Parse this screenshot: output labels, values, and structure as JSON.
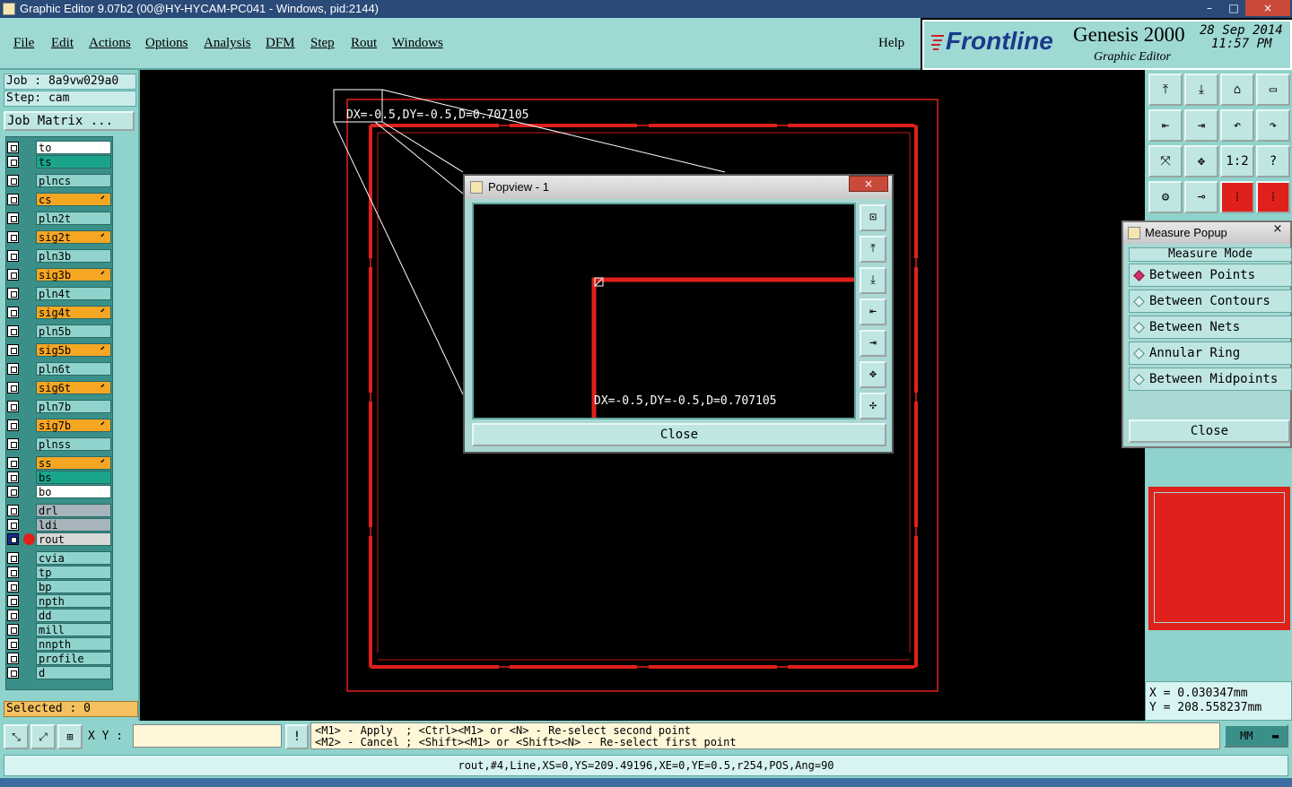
{
  "window": {
    "title": "Graphic Editor 9.07b2 (00@HY-HYCAM-PC041 - Windows, pid:2144)",
    "controls": [
      "–",
      "□",
      "×"
    ]
  },
  "menu": {
    "items": [
      "File",
      "Edit",
      "Actions",
      "Options",
      "Analysis",
      "DFM",
      "Step",
      "Rout",
      "Windows"
    ],
    "help": "Help"
  },
  "brand": {
    "logo": "Frontline",
    "product": "Genesis 2000",
    "subtitle": "Graphic Editor",
    "date": "28 Sep 2014",
    "time": "11:57 PM"
  },
  "left": {
    "job": "Job : 8a9vw029a0",
    "step": "Step: cam",
    "job_matrix": "Job Matrix ...",
    "selected": "Selected : 0"
  },
  "layers": [
    {
      "name": "to",
      "color": "#ffffff"
    },
    {
      "name": "ts",
      "color": "#1aa58a"
    },
    {
      "name": "plncs",
      "color": "#8fd3cc"
    },
    {
      "name": "cs",
      "color": "#f5a623"
    },
    {
      "name": "pln2t",
      "color": "#8fd3cc"
    },
    {
      "name": "sig2t",
      "color": "#f5a623"
    },
    {
      "name": "pln3b",
      "color": "#8fd3cc"
    },
    {
      "name": "sig3b",
      "color": "#f5a623"
    },
    {
      "name": "pln4t",
      "color": "#8fd3cc"
    },
    {
      "name": "sig4t",
      "color": "#f5a623"
    },
    {
      "name": "pln5b",
      "color": "#8fd3cc"
    },
    {
      "name": "sig5b",
      "color": "#f5a623"
    },
    {
      "name": "pln6t",
      "color": "#8fd3cc"
    },
    {
      "name": "sig6t",
      "color": "#f5a623"
    },
    {
      "name": "pln7b",
      "color": "#8fd3cc"
    },
    {
      "name": "sig7b",
      "color": "#f5a623"
    },
    {
      "name": "plnss",
      "color": "#8fd3cc"
    },
    {
      "name": "ss",
      "color": "#f5a623"
    },
    {
      "name": "bs",
      "color": "#1aa58a"
    },
    {
      "name": "bo",
      "color": "#ffffff"
    },
    {
      "name": "drl",
      "color": "#a8b4bc"
    },
    {
      "name": "ldi",
      "color": "#a8b4bc"
    },
    {
      "name": "rout",
      "color": "#d8d8d8"
    },
    {
      "name": "cvia",
      "color": "#8fd3cc"
    },
    {
      "name": "tp",
      "color": "#8fd3cc"
    },
    {
      "name": "bp",
      "color": "#8fd3cc"
    },
    {
      "name": "npth",
      "color": "#8fd3cc"
    },
    {
      "name": "dd",
      "color": "#8fd3cc"
    },
    {
      "name": "mill",
      "color": "#8fd3cc"
    },
    {
      "name": "nnpth",
      "color": "#8fd3cc"
    },
    {
      "name": "profile",
      "color": "#8fd3cc"
    },
    {
      "name": "d",
      "color": "#8fd3cc"
    }
  ],
  "canvas": {
    "measure_text": "DX=-0.5,DY=-0.5,D=0.707105"
  },
  "toolbar": {
    "icons": [
      "zoom-home-icon",
      "zoom-in-icon",
      "zoom-out-icon",
      "zoom-window-icon",
      "pan-left-icon",
      "pan-right-icon",
      "undo-icon",
      "redo-icon",
      "fit-screen-icon",
      "center-icon",
      "scale-icon",
      "help-icon",
      "filter-icon",
      "snap-icon",
      "layer-red-icon",
      "layer-red2-icon"
    ],
    "labels": [
      "",
      "",
      "",
      "",
      "",
      "",
      "",
      "",
      "",
      "",
      "1:2",
      "?",
      "",
      "",
      "",
      ""
    ]
  },
  "popview": {
    "title": "Popview - 1",
    "measure_text": "DX=-0.5,DY=-0.5,D=0.707105",
    "close_label": "Close",
    "close_x": "×"
  },
  "measure": {
    "title": "Measure Popup",
    "header": "Measure Mode",
    "options": [
      "Between Points",
      "Between Contours",
      "Between Nets",
      "Annular Ring",
      "Between Midpoints"
    ],
    "selected_index": 0,
    "close_label": "Close",
    "close_x": "×"
  },
  "coords": {
    "x": "X = 0.030347mm",
    "y": "Y = 208.558237mm"
  },
  "bottom": {
    "xy_label": "X Y :",
    "xy_value": "",
    "warn": "!",
    "msg_line1": "<M1> - Apply  ; <Ctrl><M1> or <N> - Re-select second point",
    "msg_line2": "<M2> - Cancel ; <Shift><M1> or <Shift><N> - Re-select first point",
    "units": "MM",
    "status": "rout,#4,Line,XS=0,YS=209.49196,XE=0,YE=0.5,r254,POS,Ang=90"
  }
}
